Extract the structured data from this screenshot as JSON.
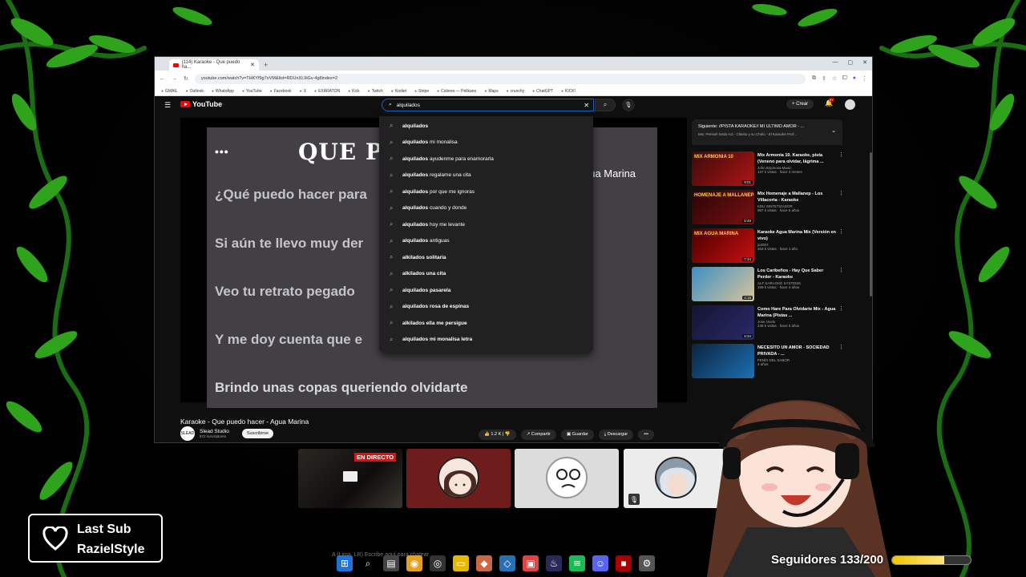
{
  "browser": {
    "tab_title": "(114) Karaoke - Que puedo ha...",
    "url": "youtube.com/watch?v=THKYf9g7oVM&list=RDUnXL9iGv-4g8index=2",
    "bookmarks": [
      "GMAIL",
      "Outlook",
      "WhatsApp",
      "YouTube",
      "Facebook",
      "X",
      "EXARATON",
      "Kick",
      "Twitch",
      "Kodiet",
      "Stripe",
      "Colores — Pelikano",
      "Maps",
      "crunchy",
      "ChatGPT",
      "KICK!"
    ]
  },
  "youtube": {
    "logo": "YouTube",
    "search_value": "alquilados",
    "create_label": "Crear",
    "notif_count": "9+",
    "suggestions": [
      {
        "bold": "alquilados",
        "rest": ""
      },
      {
        "bold": "alquilados",
        "rest": " mi monalisa"
      },
      {
        "bold": "alquilados",
        "rest": " ayudenme para enamorarla"
      },
      {
        "bold": "alquilados",
        "rest": " regalame una cita"
      },
      {
        "bold": "alquilados",
        "rest": " por que me ignoras"
      },
      {
        "bold": "alquilados",
        "rest": " cuando y donde"
      },
      {
        "bold": "alquilados",
        "rest": " hoy me levante"
      },
      {
        "bold": "alquilados",
        "rest": " antiguas"
      },
      {
        "bold": "alkilados solitaria",
        "rest": ""
      },
      {
        "bold": "alkilados una cita",
        "rest": ""
      },
      {
        "bold": "alquilados pasarela",
        "rest": ""
      },
      {
        "bold": "alquilados rosa de espinas",
        "rest": ""
      },
      {
        "bold": "alkilados ella me persigue",
        "rest": ""
      },
      {
        "bold": "alquilados mi monalisa letra",
        "rest": ""
      }
    ],
    "video": {
      "dots": "•••",
      "title_partial": "QUE P",
      "artist_partial": "gua Marina",
      "lyrics": [
        "¿Qué puedo hacer para",
        "Si aún te llevo muy der",
        "Veo tu retrato pegado",
        "Y me doy cuenta que e",
        "Brindo unas copas queriendo olvidarte"
      ]
    },
    "video_title": "Karaoke - Que puedo hacer - Agua Marina",
    "channel": {
      "name": "Slead Studio",
      "subs": "672 suscriptores",
      "subscribe": "Suscribirse",
      "avatar_text": "SLEAD"
    },
    "actions": {
      "likes": "1.2 K",
      "share": "Compartir",
      "save": "Guardar",
      "download": "Descargar",
      "more": "•••"
    },
    "up_next": {
      "title": "Siguiente: //PISTA KARAOKE// MI ULTIMO AMOR - ...",
      "subtitle": "Mix: Perisell Seda Aol - Clavito y su Chelo - El Karaoke Prof..."
    },
    "recommendations": [
      {
        "title": "Mix Armonia 10. Karaoke, pista (Veneno para olvidar, lágrima ...",
        "channel": "John Espinosa Music",
        "views": "137 k vistas · hace 4 meses",
        "duration": "9:01",
        "thumb_text": "MIX ARMONIA 10",
        "colors": [
          "#3a0a0a",
          "#b01515"
        ]
      },
      {
        "title": "Mix Homenaje a Mallanep - Los Villacorta - Karaoke",
        "channel": "KDU SINTETIZADOR",
        "views": "987 k vistas · hace 5 años",
        "duration": "5:49",
        "thumb_text": "HOMENAJE A MALLANEP",
        "colors": [
          "#2a0505",
          "#7a1010"
        ]
      },
      {
        "title": "Karaoke Agua Marina Mix (Versión en vivo)",
        "channel": "ju2007",
        "views": "263 k vistas · hace 1 año",
        "duration": "7:34",
        "thumb_text": "MIX AGUA MARINA",
        "colors": [
          "#4a0000",
          "#c81010"
        ]
      },
      {
        "title": "Los Caribeños - Hay Que Saber Perder - Karaoke",
        "channel": "ALF KARAOKE SYSTEMS",
        "views": "159 k vistas · hace 4 años",
        "duration": "4:15",
        "thumb_text": "",
        "colors": [
          "#3d8fc4",
          "#d8c49a"
        ]
      },
      {
        "title": "Como Hare Para Olvidarte Mix - Agua Marina (Pistas ...",
        "channel": "Jose Ucelo",
        "views": "248 k vistas · hace 5 años",
        "duration": "8:34",
        "thumb_text": "",
        "colors": [
          "#141432",
          "#2a2a6a"
        ]
      },
      {
        "title": "NECESITO UN AMOR - SOCIEDAD PRIVADA - ...",
        "channel": "FENIX DEL SABOR",
        "views": "4 años",
        "duration": "",
        "thumb_text": "",
        "colors": [
          "#0c2440",
          "#1d6fb0"
        ]
      }
    ]
  },
  "overlay": {
    "live_badge": "EN DIRECTO",
    "last_sub_label": "Last Sub",
    "last_sub_name": "RazielStyle",
    "followers_text": "Seguidores 133/200",
    "followers_progress": 0.665,
    "chat_hint": "A (Lima, LR) Escribe aquí para chatear"
  }
}
